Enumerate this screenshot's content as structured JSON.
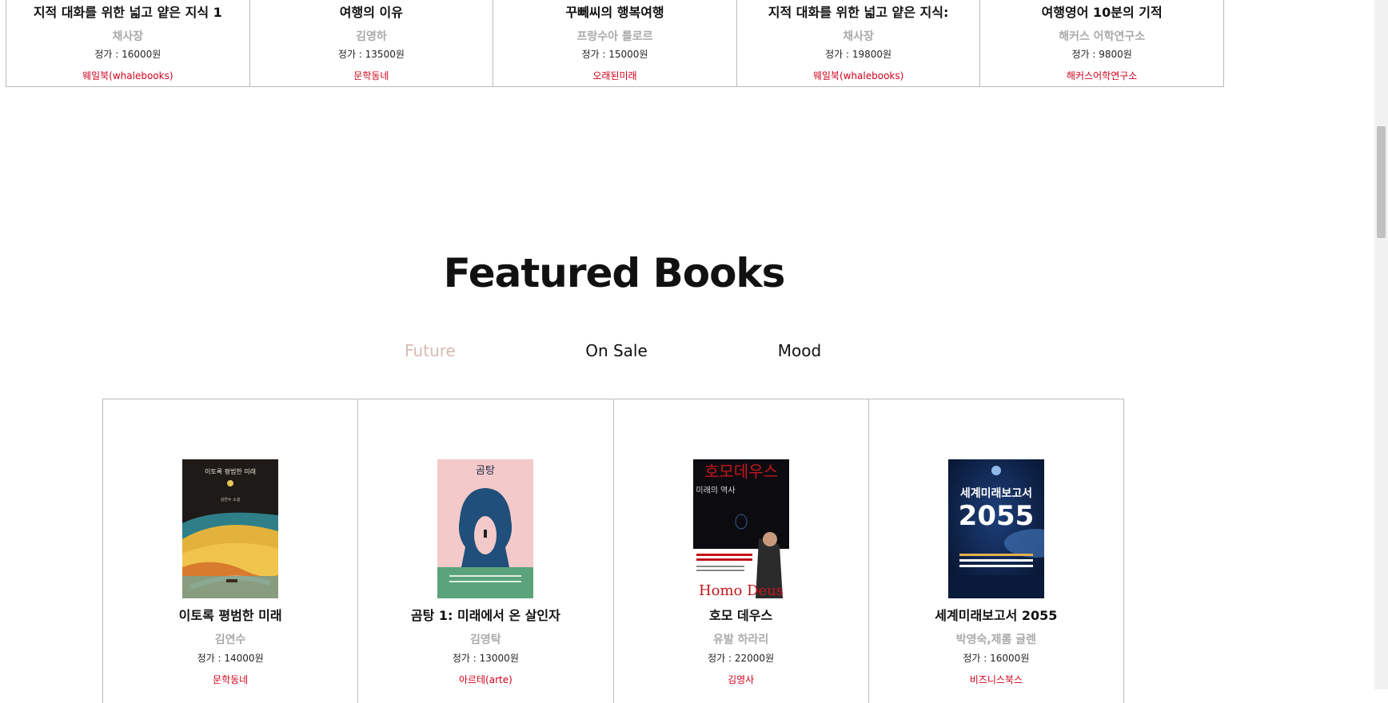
{
  "top_books": [
    {
      "title": "지적 대화를 위한 넓고 얕은 지식 1",
      "author": "채사장",
      "price": "정가 : 16000원",
      "publisher": "웨일북(whalebooks)"
    },
    {
      "title": "여행의 이유",
      "author": "김영하",
      "price": "정가 : 13500원",
      "publisher": "문학동네"
    },
    {
      "title": "꾸뻬씨의 행복여행",
      "author": "프랑수아 를로르",
      "price": "정가 : 15000원",
      "publisher": "오래된미래"
    },
    {
      "title": "지적 대화를 위한 넓고 얕은 지식:",
      "author": "채사장",
      "price": "정가 : 19800원",
      "publisher": "웨일북(whalebooks)"
    },
    {
      "title": "여행영어 10분의 기적",
      "author": "해커스 어학연구소",
      "price": "정가 : 9800원",
      "publisher": "해커스어학연구소"
    }
  ],
  "featured": {
    "title": "Featured Books",
    "tabs": [
      "Future",
      "On Sale",
      "Mood"
    ],
    "active_tab": "Future",
    "books": [
      {
        "title": "이토록 평범한 미래",
        "author": "김연수",
        "price": "정가 : 14000원",
        "publisher": "문학동네",
        "cover_title": "이토록 평범한 미래",
        "cover_author": "김연수 소설"
      },
      {
        "title": "곰탕 1: 미래에서 온 살인자",
        "author": "김영탁",
        "price": "정가 : 13000원",
        "publisher": "아르테(arte)",
        "cover_title": "곰탕"
      },
      {
        "title": "호모 데우스",
        "author": "유발 하라리",
        "price": "정가 : 22000원",
        "publisher": "김영사",
        "cover_title": "호모데우스",
        "cover_subtitle": "미래의 역사",
        "cover_en": "Homo Deus"
      },
      {
        "title": "세계미래보고서 2055",
        "author": "박영숙,제롬 글렌",
        "price": "정가 : 16000원",
        "publisher": "비즈니스북스",
        "cover_title": "세계미래보고서",
        "cover_year": "2055"
      }
    ]
  },
  "colors": {
    "accent_red": "#d0021b",
    "active_tab": "#d6bbb2",
    "muted": "#aaaaaa"
  }
}
